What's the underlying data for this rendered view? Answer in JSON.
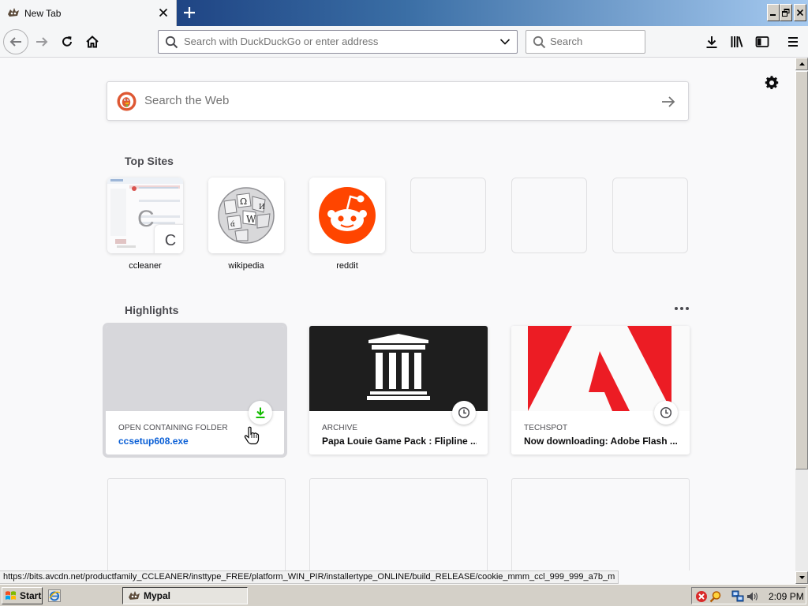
{
  "tab": {
    "title": "New Tab"
  },
  "toolbar": {
    "url_placeholder": "Search with DuckDuckGo or enter address",
    "search_placeholder": "Search"
  },
  "page": {
    "web_search_placeholder": "Search the Web",
    "top_sites_title": "Top Sites",
    "top_sites": [
      {
        "label": "ccleaner",
        "letter": "C"
      },
      {
        "label": "wikipedia"
      },
      {
        "label": "reddit"
      },
      {
        "label": ""
      },
      {
        "label": ""
      },
      {
        "label": ""
      }
    ],
    "highlights_title": "Highlights",
    "highlights": [
      {
        "source": "OPEN CONTAINING FOLDER",
        "title": "ccsetup608.exe",
        "badge": "download-icon"
      },
      {
        "source": "ARCHIVE",
        "title": "Papa Louie Game Pack : Flipline ...",
        "badge": "clock-icon"
      },
      {
        "source": "TECHSPOT",
        "title": "Now downloading: Adobe Flash ...",
        "badge": "clock-icon"
      }
    ]
  },
  "status_url": "https://bits.avcdn.net/productfamily_CCLEANER/insttype_FREE/platform_WIN_PIR/installertype_ONLINE/build_RELEASE/cookie_mmm_ccl_999_999_a7b_m",
  "taskbar": {
    "start_label": "Start",
    "task_label": "Mypal",
    "clock": "2:09 PM"
  },
  "colors": {
    "accent": "#0a5fd6",
    "reddit": "#ff4500",
    "adobe": "#ec1c24",
    "download_green": "#12bc00"
  }
}
